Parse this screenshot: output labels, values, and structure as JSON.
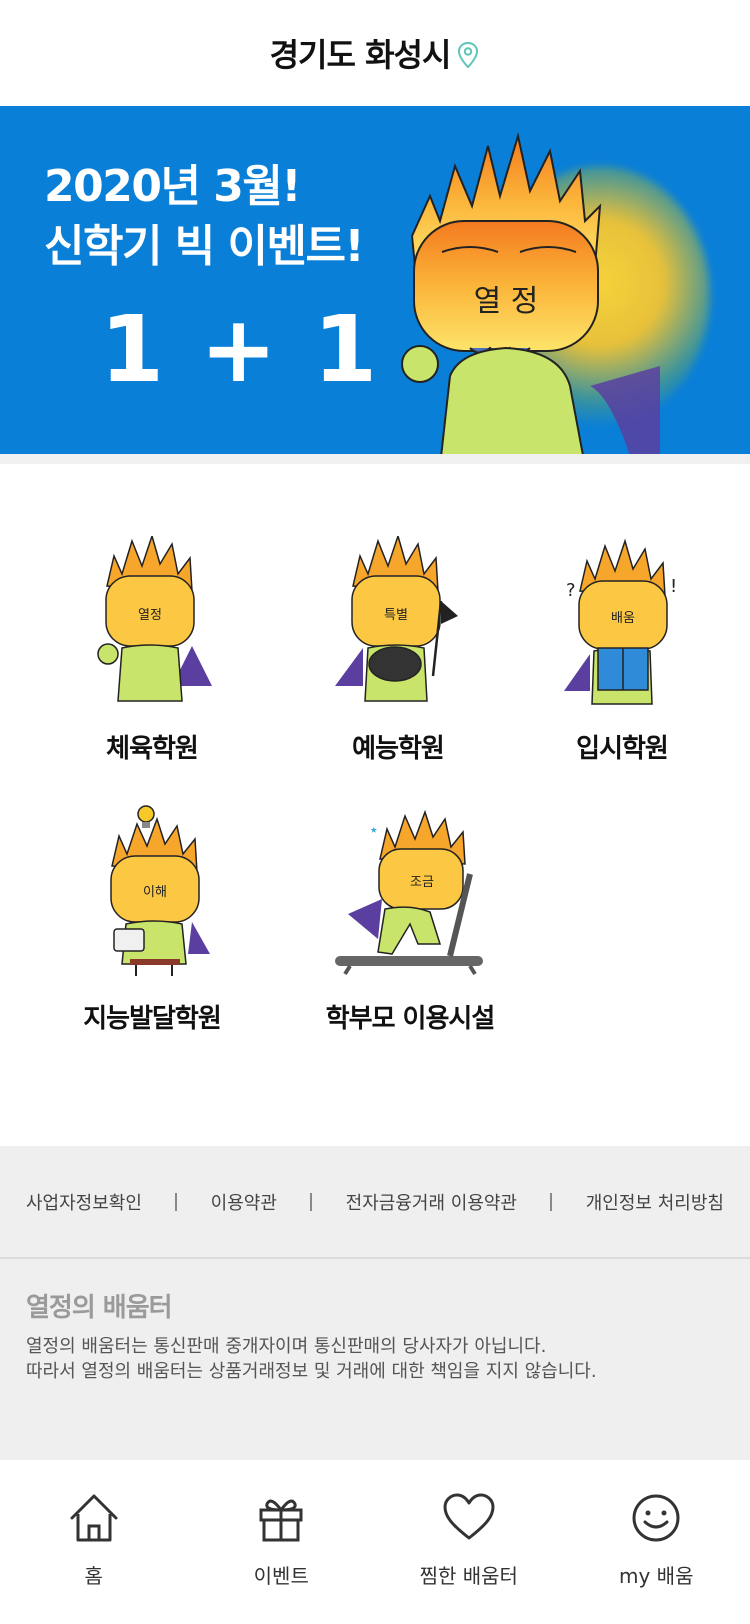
{
  "header": {
    "title": "경기도 화성시",
    "pin_icon": "location-pin-icon"
  },
  "banner": {
    "line1": "2020년 3월!",
    "line2": "신학기 빅 이벤트!",
    "promo": "1 + 1",
    "hero_face_text": "열 정",
    "bg_color": "#0a7fd8"
  },
  "categories": [
    {
      "label": "체육학원",
      "face_text": "열정"
    },
    {
      "label": "예능학원",
      "face_text": "특별"
    },
    {
      "label": "입시학원",
      "face_text": "배움"
    },
    {
      "label": "지능발달학원",
      "face_text": "이해"
    },
    {
      "label": "학부모 이용시설",
      "face_text": "조금"
    }
  ],
  "footer": {
    "links": [
      "사업자정보확인",
      "이용약관",
      "전자금융거래 이용약관",
      "개인정보 처리방침"
    ],
    "brand": "열정의 배움터",
    "disclaimer_line1": "열정의 배움터는 통신판매 중개자이며 통신판매의 당사자가 아닙니다.",
    "disclaimer_line2": "따라서 열정의 배움터는 상품거래정보 및 거래에 대한 책임을 지지 않습니다."
  },
  "tabs": [
    {
      "label": "홈",
      "icon": "home-icon"
    },
    {
      "label": "이벤트",
      "icon": "gift-icon"
    },
    {
      "label": "찜한 배움터",
      "icon": "heart-icon"
    },
    {
      "label": "my 배움",
      "icon": "smiley-icon"
    }
  ],
  "colors": {
    "accent": "#0a7fd8",
    "character_body": "#c8e46a",
    "flame": "#f5a623",
    "cape": "#5a3fa0"
  }
}
